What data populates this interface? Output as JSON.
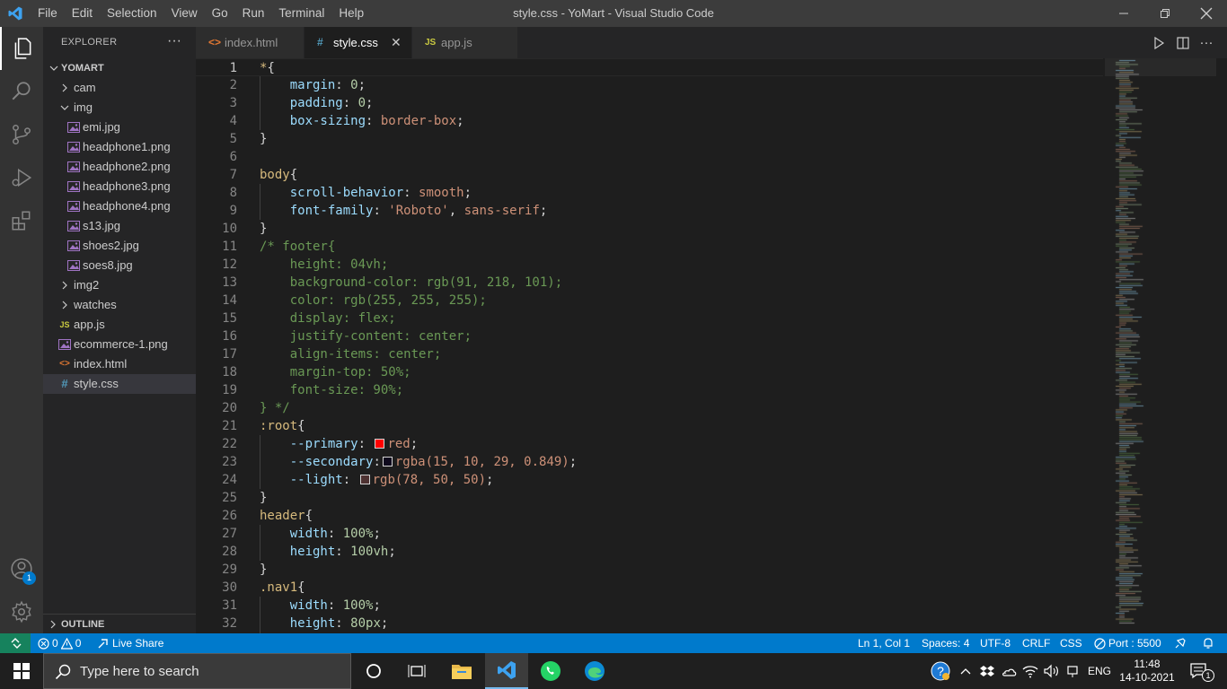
{
  "titlebar": {
    "menu": [
      "File",
      "Edit",
      "Selection",
      "View",
      "Go",
      "Run",
      "Terminal",
      "Help"
    ],
    "title": "style.css - YoMart - Visual Studio Code"
  },
  "activity": {
    "account_badge": "1"
  },
  "sidebar": {
    "title": "EXPLORER",
    "more": "···",
    "root": "YOMART",
    "items": [
      {
        "label": "cam",
        "type": "folder",
        "expanded": false,
        "depth": 1
      },
      {
        "label": "img",
        "type": "folder",
        "expanded": true,
        "depth": 1
      },
      {
        "label": "emi.jpg",
        "type": "image",
        "depth": 2
      },
      {
        "label": "headphone1.png",
        "type": "image",
        "depth": 2
      },
      {
        "label": "headphone2.png",
        "type": "image",
        "depth": 2
      },
      {
        "label": "headphone3.png",
        "type": "image",
        "depth": 2
      },
      {
        "label": "headphone4.png",
        "type": "image",
        "depth": 2
      },
      {
        "label": "s13.jpg",
        "type": "image",
        "depth": 2
      },
      {
        "label": "shoes2.jpg",
        "type": "image",
        "depth": 2
      },
      {
        "label": "soes8.jpg",
        "type": "image",
        "depth": 2
      },
      {
        "label": "img2",
        "type": "folder",
        "expanded": false,
        "depth": 1
      },
      {
        "label": "watches",
        "type": "folder",
        "expanded": false,
        "depth": 1
      },
      {
        "label": "app.js",
        "type": "js",
        "depth": 1
      },
      {
        "label": "ecommerce-1.png",
        "type": "image",
        "depth": 1
      },
      {
        "label": "index.html",
        "type": "html",
        "depth": 1
      },
      {
        "label": "style.css",
        "type": "css",
        "depth": 1,
        "selected": true
      }
    ],
    "outline": "OUTLINE"
  },
  "tabs": [
    {
      "label": "index.html",
      "icon": "<>",
      "active": false
    },
    {
      "label": "style.css",
      "icon": "#",
      "active": true
    },
    {
      "label": "app.js",
      "icon": "JS",
      "active": false
    }
  ],
  "editor": {
    "current_line": 1,
    "lines": [
      [
        [
          "sel",
          "*"
        ],
        [
          "p",
          "{"
        ]
      ],
      [
        [
          "i",
          "    "
        ],
        [
          "prop",
          "margin"
        ],
        [
          "p",
          ": "
        ],
        [
          "num",
          "0"
        ],
        [
          "p",
          ";"
        ]
      ],
      [
        [
          "i",
          "    "
        ],
        [
          "prop",
          "padding"
        ],
        [
          "p",
          ": "
        ],
        [
          "num",
          "0"
        ],
        [
          "p",
          ";"
        ]
      ],
      [
        [
          "i",
          "    "
        ],
        [
          "prop",
          "box-sizing"
        ],
        [
          "p",
          ": "
        ],
        [
          "val",
          "border-box"
        ],
        [
          "p",
          ";"
        ]
      ],
      [
        [
          "p",
          "}"
        ]
      ],
      [],
      [
        [
          "tag",
          "body"
        ],
        [
          "p",
          "{"
        ]
      ],
      [
        [
          "i",
          "    "
        ],
        [
          "prop",
          "scroll-behavior"
        ],
        [
          "p",
          ": "
        ],
        [
          "val",
          "smooth"
        ],
        [
          "p",
          ";"
        ]
      ],
      [
        [
          "i",
          "    "
        ],
        [
          "prop",
          "font-family"
        ],
        [
          "p",
          ": "
        ],
        [
          "val",
          "'Roboto'"
        ],
        [
          "p",
          ", "
        ],
        [
          "val",
          "sans-serif"
        ],
        [
          "p",
          ";"
        ]
      ],
      [
        [
          "p",
          "}"
        ]
      ],
      [
        [
          "com",
          "/* footer{"
        ]
      ],
      [
        [
          "com",
          "    height: 04vh;"
        ]
      ],
      [
        [
          "com",
          "    background-color: rgb(91, 218, 101);"
        ]
      ],
      [
        [
          "com",
          "    color: rgb(255, 255, 255);"
        ]
      ],
      [
        [
          "com",
          "    display: flex;"
        ]
      ],
      [
        [
          "com",
          "    justify-content: center;"
        ]
      ],
      [
        [
          "com",
          "    align-items: center;"
        ]
      ],
      [
        [
          "com",
          "    margin-top: 50%;"
        ]
      ],
      [
        [
          "com",
          "    font-size: 90%;"
        ]
      ],
      [
        [
          "com",
          "} */"
        ]
      ],
      [
        [
          "sel",
          ":root"
        ],
        [
          "p",
          "{"
        ]
      ],
      [
        [
          "i",
          "    "
        ],
        [
          "prop",
          "--primary"
        ],
        [
          "p",
          ": "
        ],
        [
          "sw",
          "#ff0000"
        ],
        [
          "val",
          "red"
        ],
        [
          "p",
          ";"
        ]
      ],
      [
        [
          "i",
          "    "
        ],
        [
          "prop",
          "--secondary"
        ],
        [
          "p",
          ":"
        ],
        [
          "sw",
          "#0f0a1d"
        ],
        [
          "val",
          "rgba(15, 10, 29, 0.849)"
        ],
        [
          "p",
          ";"
        ]
      ],
      [
        [
          "i",
          "    "
        ],
        [
          "prop",
          "--light"
        ],
        [
          "p",
          ": "
        ],
        [
          "sw",
          "#4e3232"
        ],
        [
          "val",
          "rgb(78, 50, 50)"
        ],
        [
          "p",
          ";"
        ]
      ],
      [
        [
          "p",
          "}"
        ]
      ],
      [
        [
          "tag",
          "header"
        ],
        [
          "p",
          "{"
        ]
      ],
      [
        [
          "i",
          "    "
        ],
        [
          "prop",
          "width"
        ],
        [
          "p",
          ": "
        ],
        [
          "num",
          "100%"
        ],
        [
          "p",
          ";"
        ]
      ],
      [
        [
          "i",
          "    "
        ],
        [
          "prop",
          "height"
        ],
        [
          "p",
          ": "
        ],
        [
          "num",
          "100vh"
        ],
        [
          "p",
          ";"
        ]
      ],
      [
        [
          "p",
          "}"
        ]
      ],
      [
        [
          "sel",
          ".nav1"
        ],
        [
          "p",
          "{"
        ]
      ],
      [
        [
          "i",
          "    "
        ],
        [
          "prop",
          "width"
        ],
        [
          "p",
          ": "
        ],
        [
          "num",
          "100%"
        ],
        [
          "p",
          ";"
        ]
      ],
      [
        [
          "i",
          "    "
        ],
        [
          "prop",
          "height"
        ],
        [
          "p",
          ": "
        ],
        [
          "num",
          "80px"
        ],
        [
          "p",
          ";"
        ]
      ]
    ]
  },
  "statusbar": {
    "errors": "0",
    "warnings": "0",
    "live_share": "Live Share",
    "position": "Ln 1, Col 1",
    "spaces": "Spaces: 4",
    "encoding": "UTF-8",
    "eol": "CRLF",
    "language": "CSS",
    "port": "Port : 5500"
  },
  "taskbar": {
    "search_placeholder": "Type here to search",
    "lang": "ENG",
    "time": "11:48",
    "date": "14-10-2021",
    "notif_count": "1"
  },
  "colors": {
    "accent": "#007acc",
    "remote": "#16825d",
    "titlebar": "#3c3c3c",
    "sidebar": "#252526",
    "editor": "#1e1e1e"
  }
}
